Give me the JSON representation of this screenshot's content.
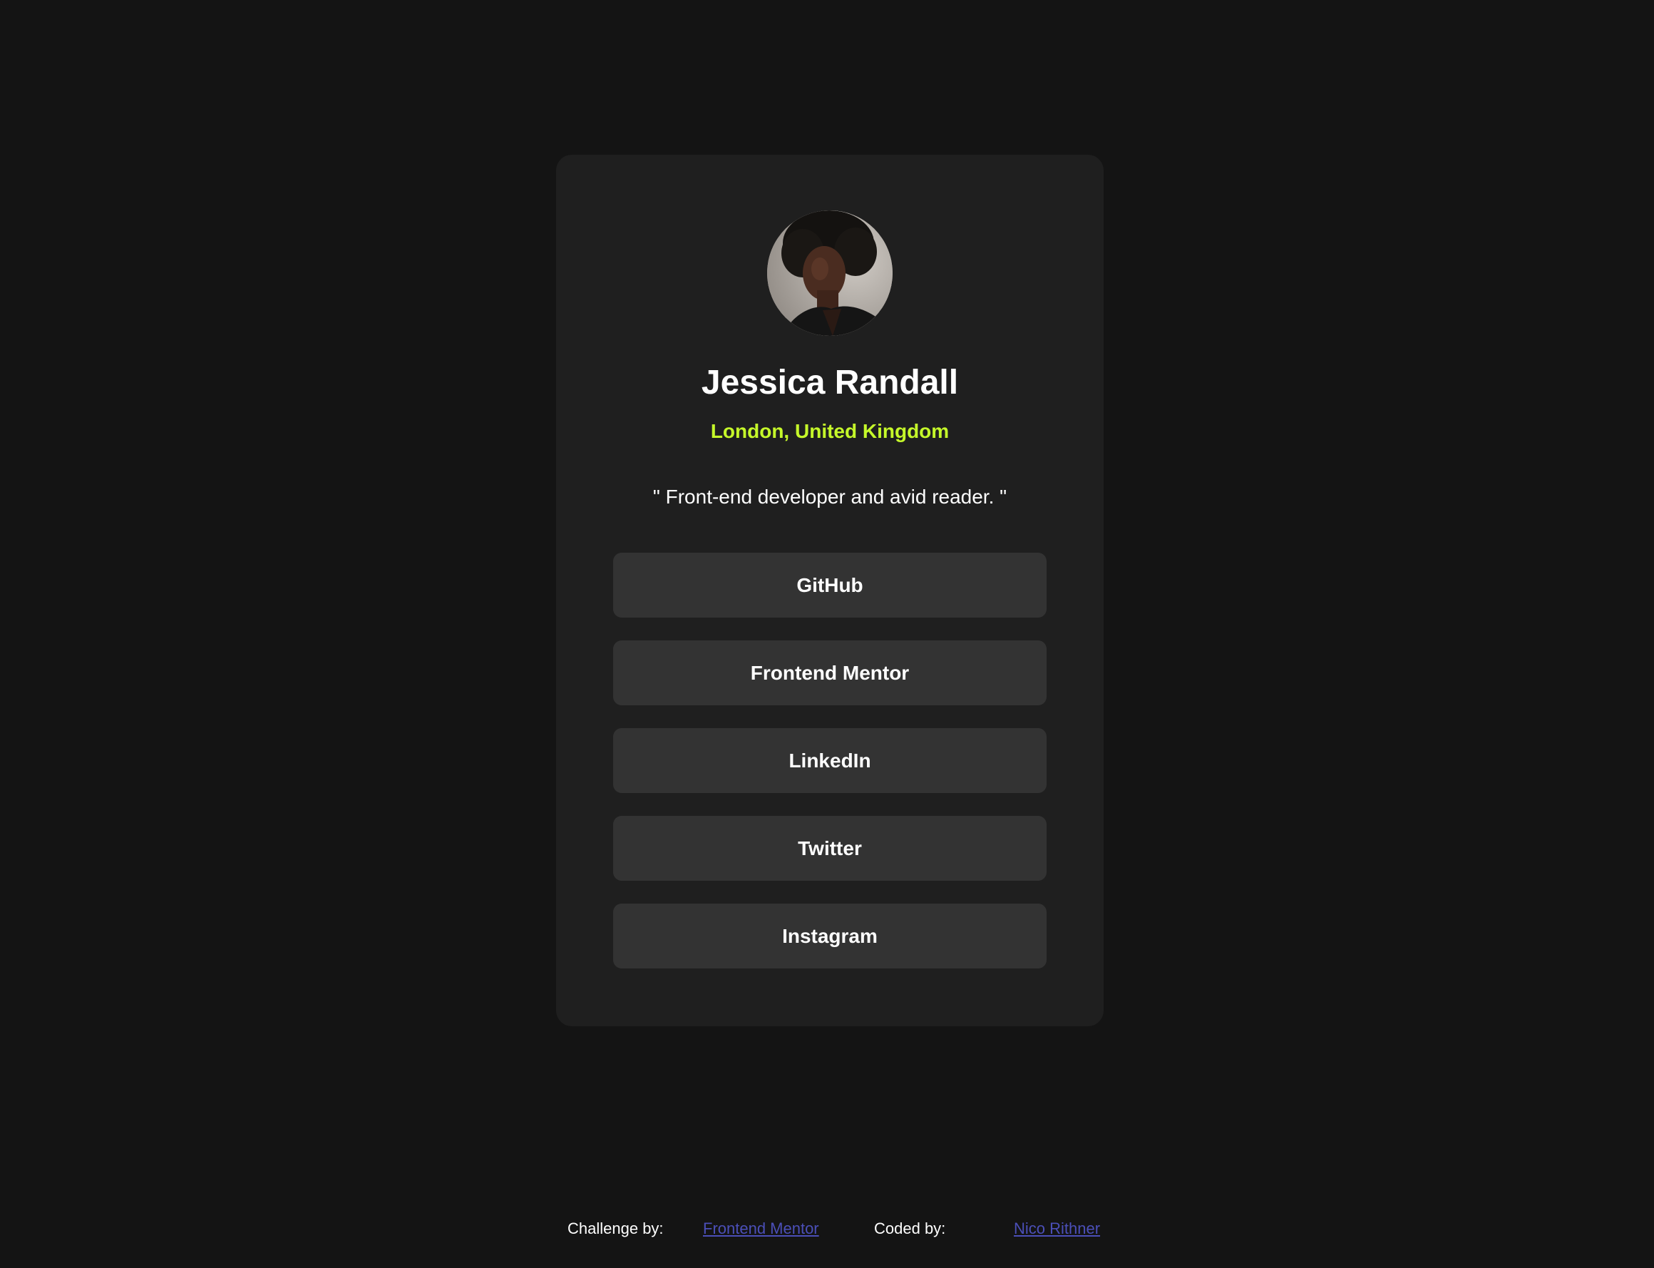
{
  "profile": {
    "name": "Jessica Randall",
    "location": "London, United Kingdom",
    "bio": "\" Front-end developer and avid reader. \""
  },
  "links": [
    {
      "label": "GitHub"
    },
    {
      "label": "Frontend Mentor"
    },
    {
      "label": "LinkedIn"
    },
    {
      "label": "Twitter"
    },
    {
      "label": "Instagram"
    }
  ],
  "footer": {
    "challenge_label": "Challenge by:",
    "challenge_link": "Frontend Mentor",
    "coded_label": "Coded by:",
    "coded_link": "Nico Rithner"
  },
  "colors": {
    "background": "#141414",
    "card": "#1f1f1f",
    "button": "#333333",
    "accent": "#c5f82a",
    "link": "#4b4fb8"
  }
}
